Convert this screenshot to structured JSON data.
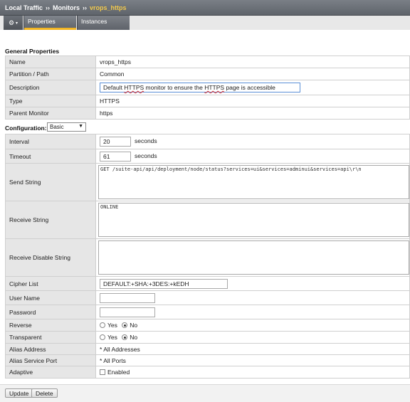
{
  "breadcrumb": {
    "part1": "Local Traffic",
    "part2": "Monitors",
    "current": "vrops_https",
    "separator": "››"
  },
  "toolbar": {
    "gear_icon": "gear-icon",
    "tabs": [
      {
        "label": "Properties",
        "active": true
      },
      {
        "label": "Instances",
        "active": false
      }
    ]
  },
  "general": {
    "title": "General Properties",
    "rows": {
      "name": {
        "label": "Name",
        "value": "vrops_https"
      },
      "partition": {
        "label": "Partition / Path",
        "value": "Common"
      },
      "description": {
        "label": "Description",
        "value_pre": "Default ",
        "value_spell": "HTTPS",
        "value_mid": " monitor to ensure the ",
        "value_spell2": "HTTPS",
        "value_post": " page is accessible"
      },
      "type": {
        "label": "Type",
        "value": "HTTPS"
      },
      "parent": {
        "label": "Parent Monitor",
        "value": "https"
      }
    }
  },
  "configuration": {
    "title": "Configuration:",
    "mode": "Basic",
    "interval": {
      "label": "Interval",
      "value": "20",
      "unit": "seconds"
    },
    "timeout": {
      "label": "Timeout",
      "value": "61",
      "unit": "seconds"
    },
    "send_string": {
      "label": "Send String",
      "value": "GET /suite-api/api/deployment/node/status?services=ui&services=adminui&services=api\\r\\n"
    },
    "receive_string": {
      "label": "Receive String",
      "value": "ONLINE"
    },
    "receive_disable": {
      "label": "Receive Disable String",
      "value": ""
    },
    "cipher_list": {
      "label": "Cipher List",
      "value": "DEFAULT:+SHA:+3DES:+kEDH"
    },
    "user_name": {
      "label": "User Name",
      "value": ""
    },
    "password": {
      "label": "Password",
      "value": ""
    },
    "reverse": {
      "label": "Reverse",
      "yes": "Yes",
      "no": "No",
      "selected": "No"
    },
    "transparent": {
      "label": "Transparent",
      "yes": "Yes",
      "no": "No",
      "selected": "No"
    },
    "alias_address": {
      "label": "Alias Address",
      "value": "* All Addresses"
    },
    "alias_port": {
      "label": "Alias Service Port",
      "value": "* All Ports"
    },
    "adaptive": {
      "label": "Adaptive",
      "checkbox_label": "Enabled",
      "checked": false
    }
  },
  "actions": {
    "update": "Update",
    "delete": "Delete"
  }
}
